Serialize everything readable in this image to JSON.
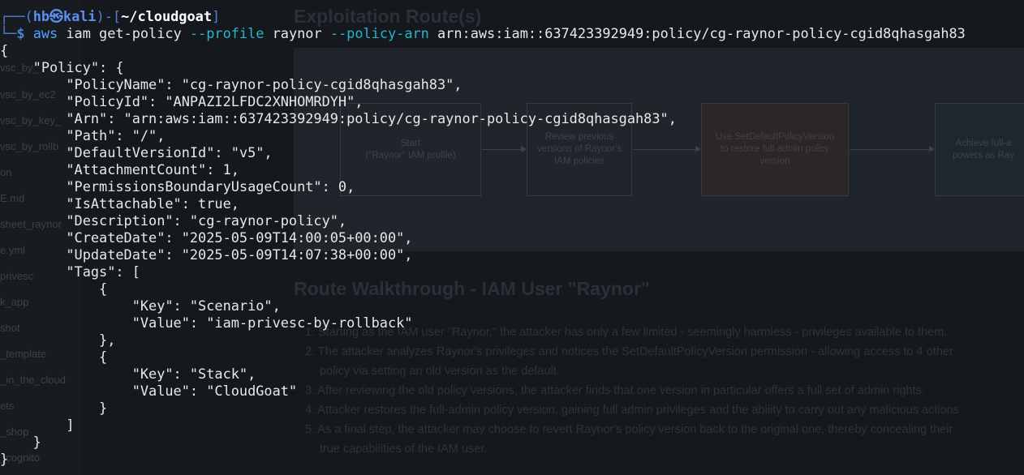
{
  "prompt": {
    "corner_top": "┌──(",
    "user": "hb",
    "at_symbol": "㉿",
    "host": "kali",
    "sep": ")-[",
    "path": "~/cloudgoat",
    "close": "]",
    "corner_bottom": "└─",
    "dollar": "$"
  },
  "command": {
    "program": "aws",
    "args_1": " iam get-policy ",
    "flag_profile": "--profile",
    "profile_value": " raynor ",
    "flag_policy_arn": "--policy-arn",
    "arn_value": " arn:aws:iam::637423392949:policy/cg-raynor-policy-cgid8qhasgah83"
  },
  "output_lines": [
    "{",
    "    \"Policy\": {",
    "        \"PolicyName\": \"cg-raynor-policy-cgid8qhasgah83\",",
    "        \"PolicyId\": \"ANPAZI2LFDC2XNHOMRDYH\",",
    "        \"Arn\": \"arn:aws:iam::637423392949:policy/cg-raynor-policy-cgid8qhasgah83\",",
    "        \"Path\": \"/\",",
    "        \"DefaultVersionId\": \"v5\",",
    "        \"AttachmentCount\": 1,",
    "        \"PermissionsBoundaryUsageCount\": 0,",
    "        \"IsAttachable\": true,",
    "        \"Description\": \"cg-raynor-policy\",",
    "        \"CreateDate\": \"2025-05-09T14:00:05+00:00\",",
    "        \"UpdateDate\": \"2025-05-09T14:07:38+00:00\",",
    "        \"Tags\": [",
    "            {",
    "                \"Key\": \"Scenario\",",
    "                \"Value\": \"iam-privesc-by-rollback\"",
    "            },",
    "            {",
    "                \"Key\": \"Stack\",",
    "                \"Value\": \"CloudGoat\"",
    "            }",
    "        ]",
    "    }",
    "}"
  ],
  "background_page": {
    "heading_exploitation": "Exploitation Route(s)",
    "heading_walkthrough": "Route Walkthrough - IAM User \"Raynor\"",
    "diagram_boxes": [
      "Start\n(\"Raynor\" IAM profile)",
      "Review previous\nversions of Raynor's\nIAM policies",
      "Use SetDefaultPolicyVersion\nto restore full-admin policy\nversion",
      "Achieve full-a\npowers as Ray"
    ],
    "steps": [
      "1. Starting as the IAM user \"Raynor,\" the attacker has only a few limited - seemingly harmless - privileges available to them.",
      "2. The attacker analyzes Raynor's privileges and notices the SetDefaultPolicyVersion permission - allowing access to 4 other",
      "policy via setting an old version as the default.",
      "3. After reviewing the old policy versions, the attacker finds that one version in particular offers a full set of admin rights.",
      "4. Attacker restores the full-admin policy version, gaining full admin privileges and the ability to carry out any malicious actions",
      "5. As a final step, the attacker may choose to revert Raynor's policy version back to the original one, thereby concealing their",
      "true capabilities of the IAM user."
    ],
    "sidebar_files": [
      "vsc_by_",
      "vsc_by_ec2",
      "vsc_by_key_",
      "vsc_by_rollb",
      "on",
      "E.md",
      "sheet_raynor",
      "e.yml",
      "privesc",
      "k_app",
      "shot",
      "_template",
      "_in_the_cloud",
      "ets",
      "_shop",
      "_cognito"
    ]
  }
}
